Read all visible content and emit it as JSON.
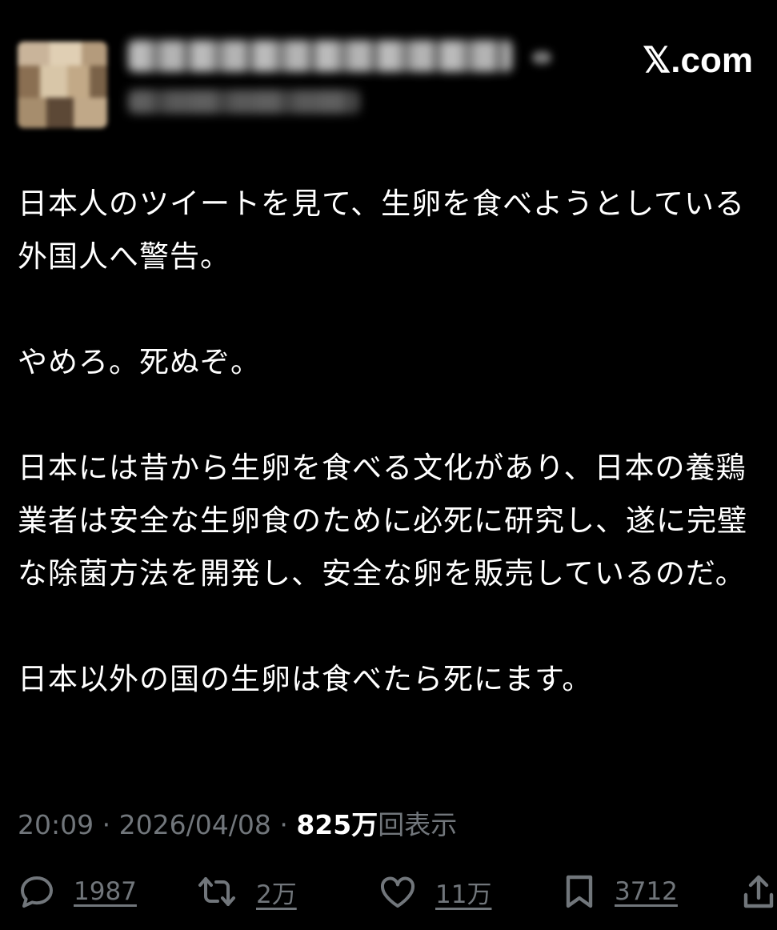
{
  "header": {
    "brand": "𝕏.com"
  },
  "post": {
    "paragraphs": [
      "日本人のツイートを見て、生卵を食べようとしている外国人へ警告。",
      "やめろ。死ぬぞ。",
      "日本には昔から生卵を食べる文化があり、日本の養鶏業者は安全な生卵食のために必死に研究し、遂に完璧な除菌方法を開発し、安全な卵を販売しているのだ。",
      "日本以外の国の生卵は食べたら死にます。"
    ]
  },
  "meta": {
    "time": "20:09",
    "separator": "·",
    "date": "2026/04/08",
    "views_count": "825万",
    "views_label": "回表示"
  },
  "actions": {
    "replies": "1987",
    "reposts": "2万",
    "likes": "11万",
    "bookmarks": "3712"
  },
  "icons": [
    "reply-icon",
    "repost-icon",
    "like-icon",
    "bookmark-icon",
    "share-icon"
  ],
  "colors": {
    "background": "#000000",
    "text": "#ffffff",
    "muted": "#71767b"
  }
}
